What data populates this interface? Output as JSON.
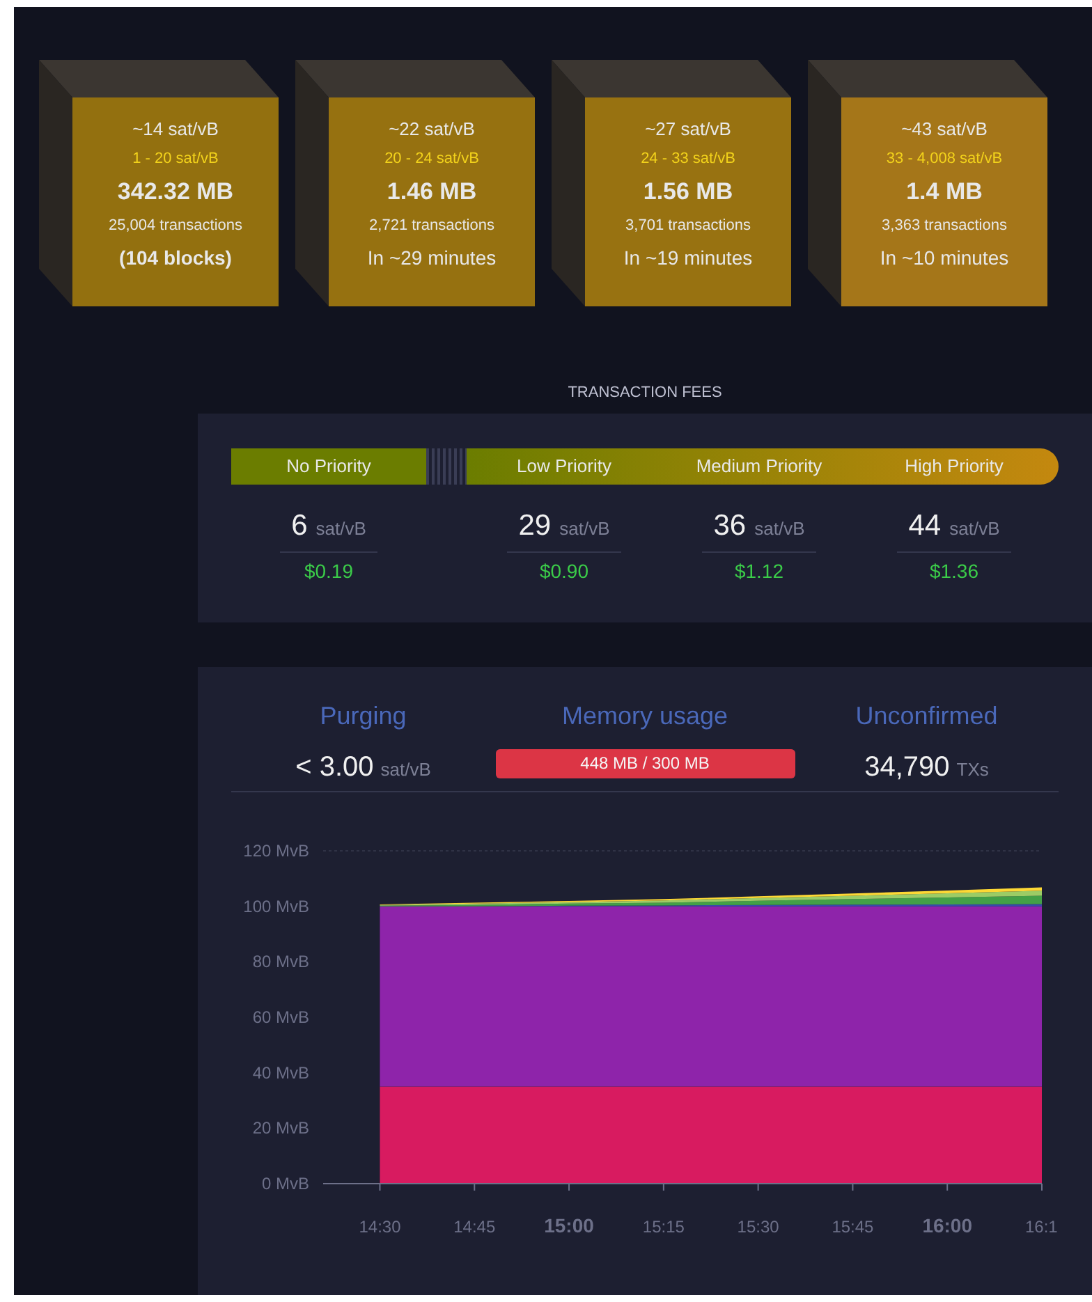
{
  "blocks": [
    {
      "fee": "~14 sat/vB",
      "range": "1 - 20 sat/vB",
      "size": "342.32 MB",
      "transactions": "25,004 transactions",
      "eta": "(104 blocks)",
      "eta_bold": true,
      "color": "#93700f"
    },
    {
      "fee": "~22 sat/vB",
      "range": "20 - 24 sat/vB",
      "size": "1.46 MB",
      "transactions": "2,721 transactions",
      "eta": "In ~29 minutes",
      "eta_bold": false,
      "color": "#967110"
    },
    {
      "fee": "~27 sat/vB",
      "range": "24 - 33 sat/vB",
      "size": "1.56 MB",
      "transactions": "3,701 transactions",
      "eta": "In ~19 minutes",
      "eta_bold": false,
      "color": "#987211"
    },
    {
      "fee": "~43 sat/vB",
      "range": "33 - 4,008 sat/vB",
      "size": "1.4 MB",
      "transactions": "3,363 transactions",
      "eta": "In ~10 minutes",
      "eta_bold": false,
      "color": "#a57619"
    }
  ],
  "fees": {
    "title": "TRANSACTION FEES",
    "priorities": [
      {
        "label": "No Priority",
        "value": "6",
        "unit": "sat/vB",
        "usd": "$0.19"
      },
      {
        "label": "Low Priority",
        "value": "29",
        "unit": "sat/vB",
        "usd": "$0.90"
      },
      {
        "label": "Medium Priority",
        "value": "36",
        "unit": "sat/vB",
        "usd": "$1.12"
      },
      {
        "label": "High Priority",
        "value": "44",
        "unit": "sat/vB",
        "usd": "$1.36"
      }
    ]
  },
  "mempool": {
    "purging": {
      "label": "Purging",
      "value": "< 3.00",
      "unit": "sat/vB"
    },
    "memory": {
      "label": "Memory usage",
      "reading": "448 MB / 300 MB",
      "level": 1
    },
    "unconfirmed": {
      "label": "Unconfirmed",
      "value": "34,790",
      "unit": "TXs"
    },
    "chart_data": {
      "type": "area",
      "stacked": true,
      "categories": [
        "14:30",
        "14:45",
        "15:00",
        "15:15",
        "15:30",
        "15:45",
        "16:00",
        "16:1"
      ],
      "series": [
        {
          "color": "#d81b60",
          "values": [
            35,
            35,
            35,
            35,
            35,
            35,
            35,
            35
          ]
        },
        {
          "color": "#8e24aa",
          "values": [
            65,
            65,
            65,
            65,
            65,
            65,
            65,
            65
          ]
        },
        {
          "color": "#3949ab",
          "values": [
            0,
            0,
            0.2,
            0.3,
            0.5,
            0.6,
            0.7,
            0.8
          ]
        },
        {
          "color": "#43a047",
          "values": [
            0.2,
            0.5,
            0.8,
            1,
            1.5,
            2,
            2.5,
            3
          ]
        },
        {
          "color": "#9ccc65",
          "values": [
            0.3,
            0.5,
            0.5,
            0.8,
            1,
            1.2,
            1.5,
            1.8
          ]
        },
        {
          "color": "#fdd835",
          "values": [
            0.2,
            0.3,
            0.4,
            0.5,
            0.6,
            0.8,
            1,
            1.2
          ]
        }
      ],
      "ylim": [
        0,
        120
      ],
      "yticks": [
        {
          "value": 0,
          "label": "0 MvB"
        },
        {
          "value": 20,
          "label": "20 MvB"
        },
        {
          "value": 40,
          "label": "40 MvB"
        },
        {
          "value": 60,
          "label": "60 MvB"
        },
        {
          "value": 80,
          "label": "80 MvB"
        },
        {
          "value": 100,
          "label": "100 MvB"
        },
        {
          "value": 120,
          "label": "120 MvB"
        }
      ]
    }
  }
}
